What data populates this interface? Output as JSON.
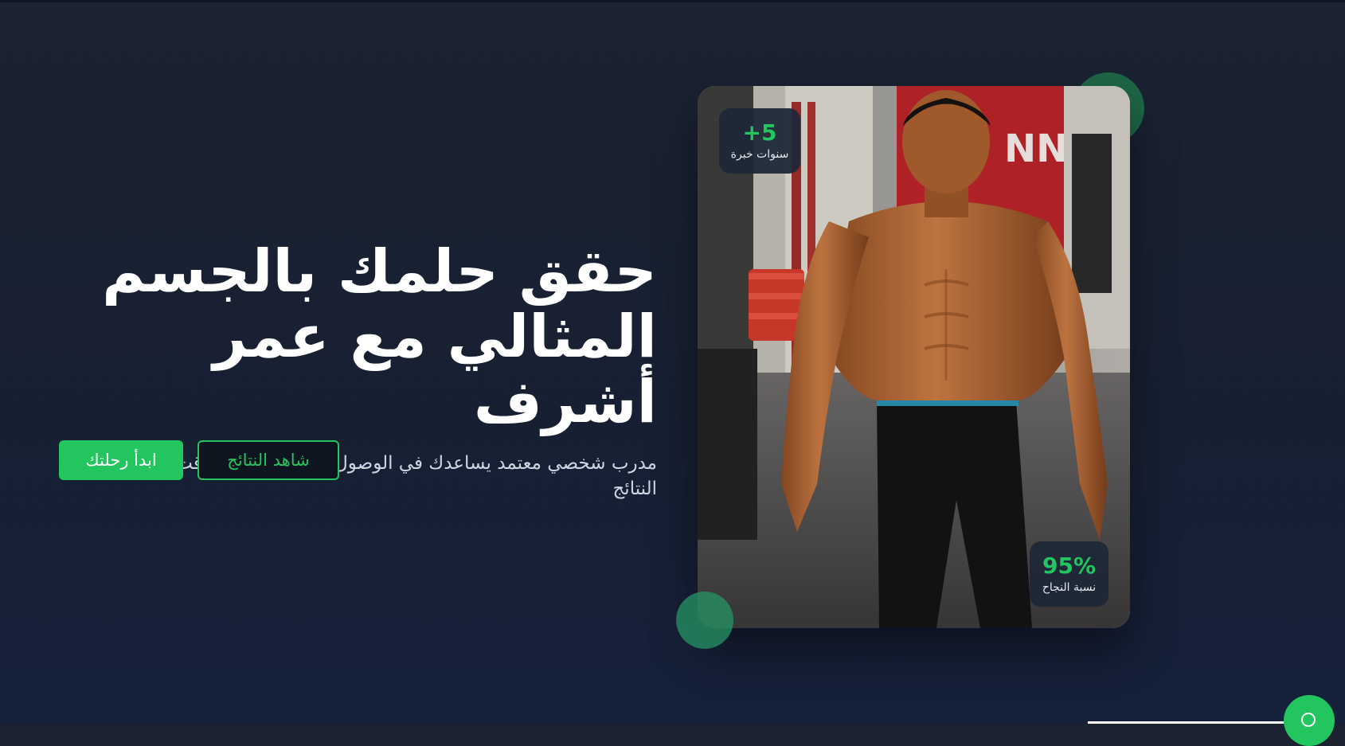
{
  "hero": {
    "title_line1": "حقق حلمك بالجسم",
    "title_line2": "المثالي مع عمر أشرف",
    "subtitle": "مدرب شخصي معتمد يساعدك في الوصول لأهدافك بأسرع وقت وأفضل النتائج"
  },
  "buttons": {
    "start_label": "ابدأ رحلتك",
    "results_label": "شاهد النتائج"
  },
  "stats": {
    "experience": {
      "value": "5+",
      "label": "سنوات خبرة"
    },
    "success": {
      "value": "95%",
      "label": "نسبة النجاح"
    }
  },
  "image": {
    "description_icon": "trainer-photo",
    "wall_sign_text": "NNY"
  },
  "colors": {
    "accent": "#22c55e",
    "background": "#1b2230",
    "badge_bg": "#1e2737",
    "text_muted": "#cfd6df"
  },
  "icons": {
    "chat": "chat-bubble-icon"
  }
}
